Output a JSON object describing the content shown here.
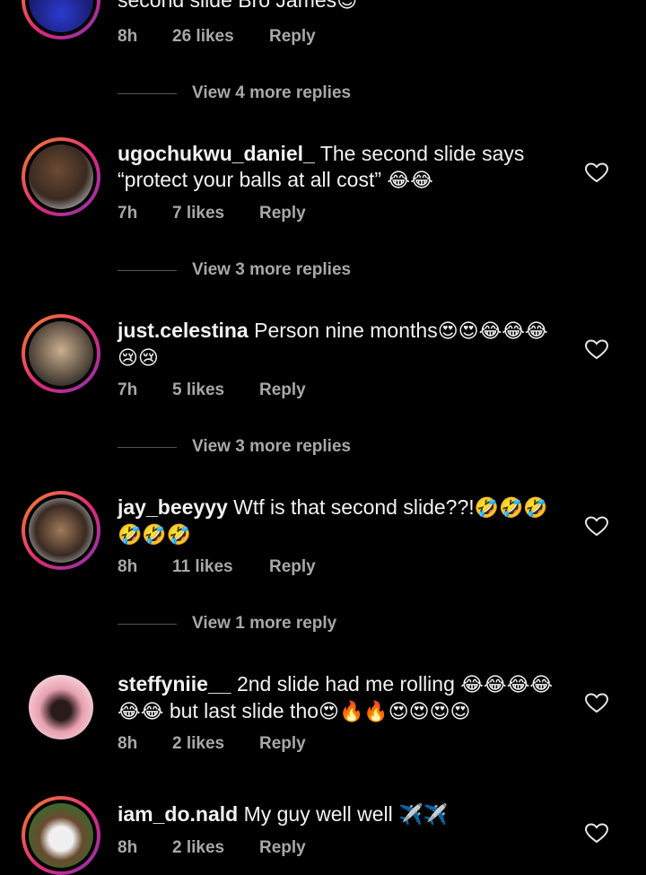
{
  "comments": [
    {
      "text": "second slide Bro James",
      "emoji": "😌",
      "time": "8h",
      "likes": "26 likes",
      "reply": "Reply"
    },
    {
      "username": "ugochukwu_daniel_",
      "text": "The second slide says “protect your balls at all cost”",
      "emoji": "😂😂",
      "time": "7h",
      "likes": "7 likes",
      "reply": "Reply"
    },
    {
      "username": "just.celestina",
      "text": "Person nine months",
      "emoji": "😍😍😂😂😂😢😢",
      "time": "7h",
      "likes": "5 likes",
      "reply": "Reply"
    },
    {
      "username": "jay_beeyyy",
      "text": "Wtf is that second slide??!",
      "emoji": "🤣🤣🤣🤣🤣🤣",
      "time": "8h",
      "likes": "11 likes",
      "reply": "Reply"
    },
    {
      "username": "steffyniie__",
      "text": "2nd slide had me rolling",
      "emoji": "😂😂😂😂😂😂",
      "text2": "but last slide tho",
      "emoji2": "😍🔥🔥😍😍😍😍",
      "time": "8h",
      "likes": "2 likes",
      "reply": "Reply"
    },
    {
      "username": "iam_do.nald",
      "text": "My guy well well",
      "emoji": "✈️✈️",
      "time": "8h",
      "likes": "2 likes",
      "reply": "Reply"
    }
  ],
  "view_more": [
    "View 4 more replies",
    "View 3 more replies",
    "View 3 more replies",
    "View 1 more reply"
  ],
  "colors": {
    "background": "#000000",
    "meta_text": "#a8a8a8",
    "story_ring_start": "#f58529",
    "story_ring_end": "#8134af"
  },
  "icons": {
    "like": "heart-outline-icon"
  }
}
